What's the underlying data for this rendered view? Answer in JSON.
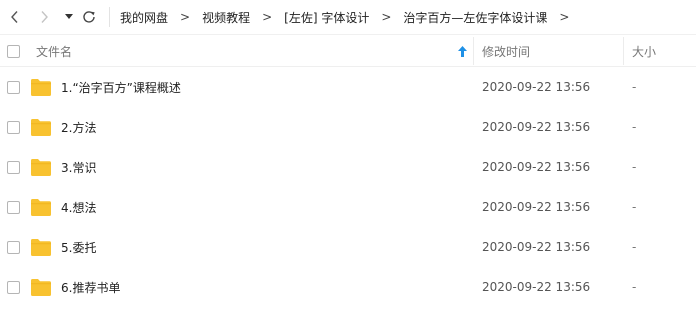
{
  "toolbar": {
    "icons": {
      "back": "chevron-left-icon",
      "forward": "chevron-right-icon",
      "history": "caret-down-icon",
      "refresh": "refresh-icon"
    }
  },
  "breadcrumb": {
    "items": [
      {
        "label": "我的网盘"
      },
      {
        "label": "视频教程"
      },
      {
        "label": "[左佐] 字体设计"
      },
      {
        "label": "治字百方—左佐字体设计课"
      }
    ],
    "separator": ">"
  },
  "columns": {
    "name": "文件名",
    "modified": "修改时间",
    "size": "大小",
    "sort_icon": "arrow-up-icon"
  },
  "colors": {
    "folder": "#f8c230",
    "sort_arrow": "#1e90e6"
  },
  "files": [
    {
      "name": "1.“治字百方”课程概述",
      "modified": "2020-09-22 13:56",
      "size": "-"
    },
    {
      "name": "2.方法",
      "modified": "2020-09-22 13:56",
      "size": "-"
    },
    {
      "name": "3.常识",
      "modified": "2020-09-22 13:56",
      "size": "-"
    },
    {
      "name": "4.想法",
      "modified": "2020-09-22 13:56",
      "size": "-"
    },
    {
      "name": "5.委托",
      "modified": "2020-09-22 13:56",
      "size": "-"
    },
    {
      "name": "6.推荐书单",
      "modified": "2020-09-22 13:56",
      "size": "-"
    }
  ]
}
